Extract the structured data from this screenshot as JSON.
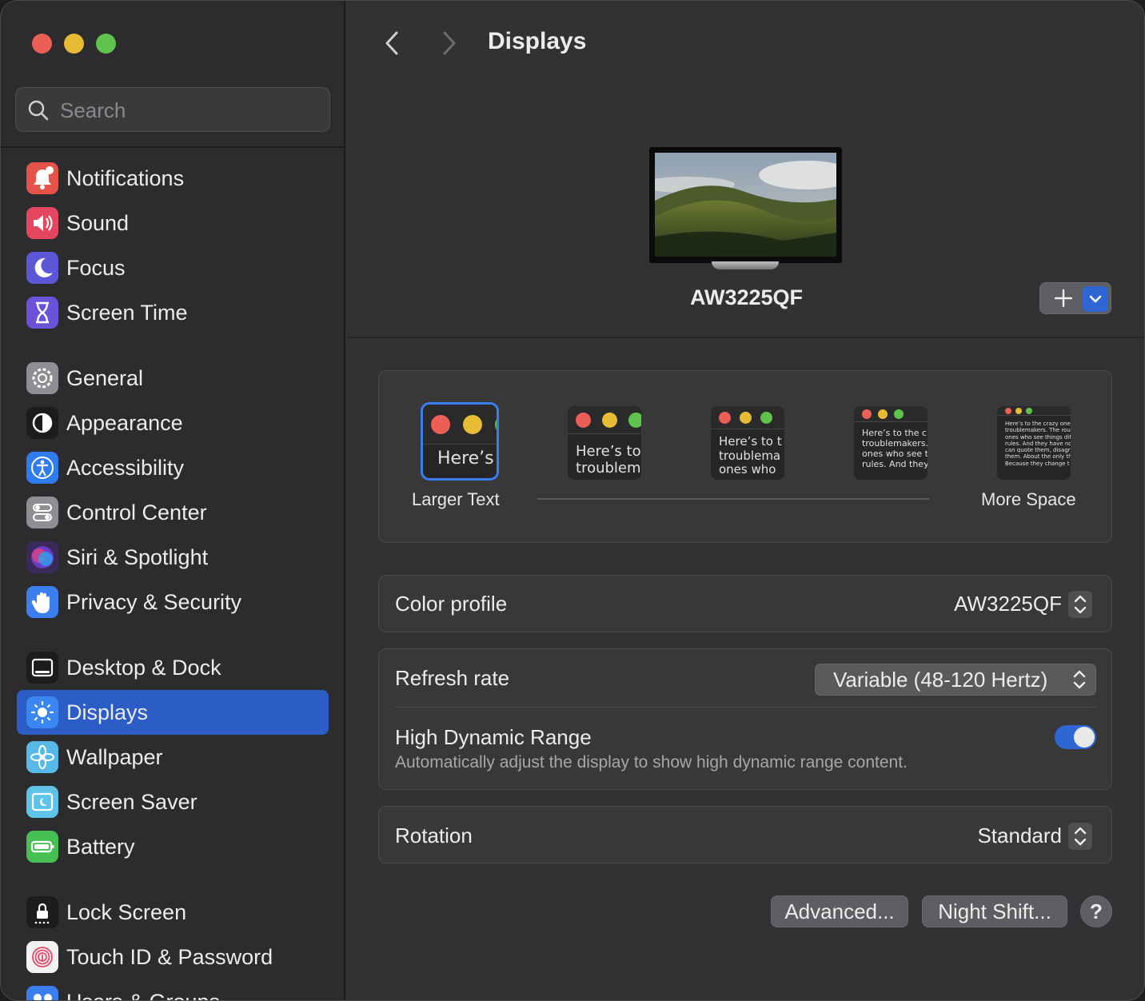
{
  "sidebar": {
    "search_placeholder": "Search",
    "groups": [
      [
        {
          "label": "Notifications",
          "icon": "bell-badge-icon",
          "color": "#e5524a"
        },
        {
          "label": "Sound",
          "icon": "speaker-icon",
          "color": "#e5465f"
        },
        {
          "label": "Focus",
          "icon": "moon-icon",
          "color": "#5b57d6"
        },
        {
          "label": "Screen Time",
          "icon": "hourglass-icon",
          "color": "#6b52d9"
        }
      ],
      [
        {
          "label": "General",
          "icon": "gear-icon",
          "color": "#8e8e93"
        },
        {
          "label": "Appearance",
          "icon": "appearance-icon",
          "color": "#1c1c1e"
        },
        {
          "label": "Accessibility",
          "icon": "accessibility-icon",
          "color": "#2f7cf0"
        },
        {
          "label": "Control Center",
          "icon": "toggles-icon",
          "color": "#8e8e93"
        },
        {
          "label": "Siri & Spotlight",
          "icon": "siri-icon",
          "color": "#3a2a5a"
        },
        {
          "label": "Privacy & Security",
          "icon": "hand-icon",
          "color": "#3a7ef0"
        }
      ],
      [
        {
          "label": "Desktop & Dock",
          "icon": "dock-icon",
          "color": "#1c1c1e"
        },
        {
          "label": "Displays",
          "icon": "sun-icon",
          "color": "#3a86f2",
          "active": true
        },
        {
          "label": "Wallpaper",
          "icon": "flower-icon",
          "color": "#58b8e8"
        },
        {
          "label": "Screen Saver",
          "icon": "screensaver-icon",
          "color": "#5ec3e8"
        },
        {
          "label": "Battery",
          "icon": "battery-icon",
          "color": "#46c052"
        }
      ],
      [
        {
          "label": "Lock Screen",
          "icon": "lock-icon",
          "color": "#1c1c1e"
        },
        {
          "label": "Touch ID & Password",
          "icon": "fingerprint-icon",
          "color": "#f2f2f2"
        },
        {
          "label": "Users & Groups",
          "icon": "users-icon",
          "color": "#3a7ef0"
        }
      ]
    ]
  },
  "header": {
    "title": "Displays"
  },
  "display": {
    "name": "AW3225QF"
  },
  "resolution": {
    "options": [
      {
        "text": "Here’s"
      },
      {
        "text": "Here’s to\ntroublem"
      },
      {
        "text": "Here’s to t\ntroublema\nones who"
      },
      {
        "text": "Here’s to the cr\ntroublemakers.\nones who see t\nrules. And they"
      },
      {
        "text": "Here’s to the crazy one\ntroublemakers. The rou\nones who see things dif\nrules. And they have no\ncan quote them, disagr\nthem. About the only th\nBecause they change t"
      }
    ],
    "selected_index": 0,
    "left_label": "Larger Text",
    "right_label": "More Space"
  },
  "color_profile": {
    "label": "Color profile",
    "value": "AW3225QF"
  },
  "refresh_rate": {
    "label": "Refresh rate",
    "value": "Variable (48-120 Hertz)"
  },
  "hdr": {
    "label": "High Dynamic Range",
    "description": "Automatically adjust the display to show high dynamic range content.",
    "enabled": true
  },
  "rotation": {
    "label": "Rotation",
    "value": "Standard"
  },
  "buttons": {
    "advanced": "Advanced...",
    "night_shift": "Night Shift...",
    "help": "?"
  },
  "colors": {
    "accent": "#2f66d4",
    "close": "#ec5f57",
    "minimize": "#e6bc34",
    "zoom": "#5fc24c"
  }
}
